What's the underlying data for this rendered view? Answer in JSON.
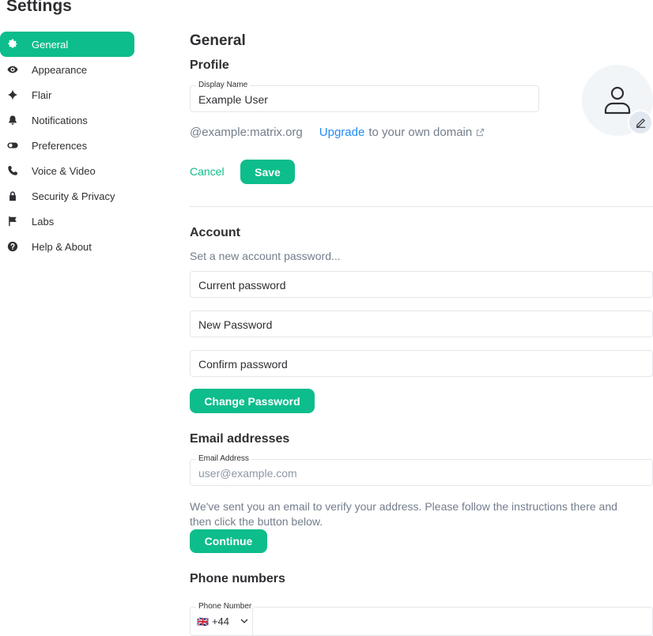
{
  "page": {
    "title": "Settings"
  },
  "sidebar": {
    "items": [
      {
        "label": "General",
        "icon": "gear-icon",
        "active": true
      },
      {
        "label": "Appearance",
        "icon": "eye-icon"
      },
      {
        "label": "Flair",
        "icon": "sparkle-icon"
      },
      {
        "label": "Notifications",
        "icon": "bell-icon"
      },
      {
        "label": "Preferences",
        "icon": "toggle-icon"
      },
      {
        "label": "Voice & Video",
        "icon": "phone-icon"
      },
      {
        "label": "Security & Privacy",
        "icon": "lock-icon"
      },
      {
        "label": "Labs",
        "icon": "flag-icon"
      },
      {
        "label": "Help & About",
        "icon": "help-icon"
      }
    ]
  },
  "general": {
    "heading": "General",
    "profile": {
      "heading": "Profile",
      "display_name_label": "Display Name",
      "display_name_value": "Example User",
      "user_id": "@example:matrix.org",
      "upgrade_link": "Upgrade",
      "upgrade_suffix": "to your own domain",
      "cancel_label": "Cancel",
      "save_label": "Save"
    },
    "account": {
      "heading": "Account",
      "subtitle": "Set a new account password...",
      "current_password_placeholder": "Current password",
      "new_password_placeholder": "New Password",
      "confirm_password_placeholder": "Confirm password",
      "change_password_label": "Change Password"
    },
    "email": {
      "heading": "Email addresses",
      "field_label": "Email Address",
      "placeholder": "user@example.com",
      "notice": "We've sent you an email to verify your address. Please follow the instructions there and then click the button below.",
      "continue_label": "Continue"
    },
    "phone": {
      "heading": "Phone numbers",
      "field_label": "Phone Number",
      "country_code": "+44",
      "flag": "🇬🇧"
    }
  },
  "colors": {
    "accent": "#0dbd8b",
    "link": "#238cf5",
    "muted_text": "#737d8c",
    "border": "#e3e6ea"
  }
}
